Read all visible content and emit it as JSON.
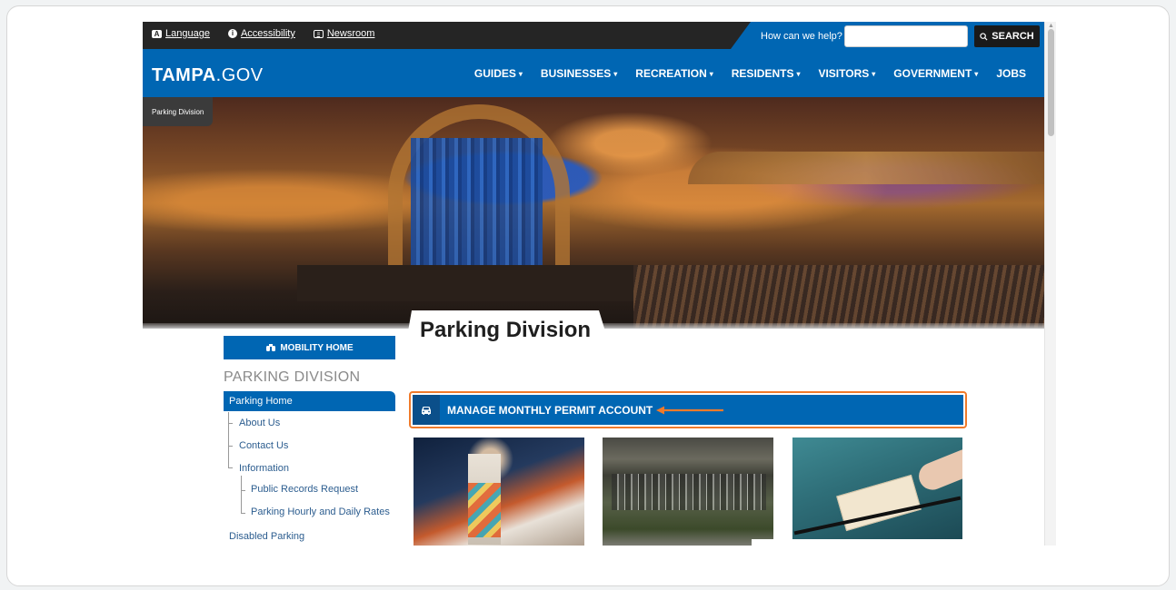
{
  "utility": {
    "links": [
      {
        "label": "Language",
        "icon": "language-icon"
      },
      {
        "label": "Accessibility",
        "icon": "accessibility-icon"
      },
      {
        "label": "Newsroom",
        "icon": "newsroom-icon"
      }
    ],
    "help_label": "How can we help?",
    "search_placeholder": "",
    "search_button": "SEARCH"
  },
  "header": {
    "logo_bold": "TAMPA",
    "logo_rest": ".GOV",
    "nav": [
      {
        "label": "GUIDES",
        "has_caret": true
      },
      {
        "label": "BUSINESSES",
        "has_caret": true
      },
      {
        "label": "RECREATION",
        "has_caret": true
      },
      {
        "label": "RESIDENTS",
        "has_caret": true
      },
      {
        "label": "VISITORS",
        "has_caret": true
      },
      {
        "label": "GOVERNMENT",
        "has_caret": true
      },
      {
        "label": "JOBS",
        "has_caret": false
      }
    ],
    "caret": "▾"
  },
  "breadcrumb": "Parking Division",
  "page_title": "Parking Division",
  "sidebar": {
    "mobility_button": "MOBILITY HOME",
    "heading": "PARKING DIVISION",
    "active_item": "Parking Home",
    "items": [
      {
        "label": "About Us"
      },
      {
        "label": "Contact Us"
      },
      {
        "label": "Information"
      },
      {
        "label": "Public Records Request"
      },
      {
        "label": "Parking Hourly and Daily Rates"
      },
      {
        "label": "Disabled Parking"
      }
    ]
  },
  "main": {
    "permit_button": "MANAGE MONTHLY PERMIT ACCOUNT"
  },
  "colors": {
    "brand_blue": "#0066b3",
    "highlight_orange": "#f07a2a",
    "utility_bar": "#252525"
  }
}
